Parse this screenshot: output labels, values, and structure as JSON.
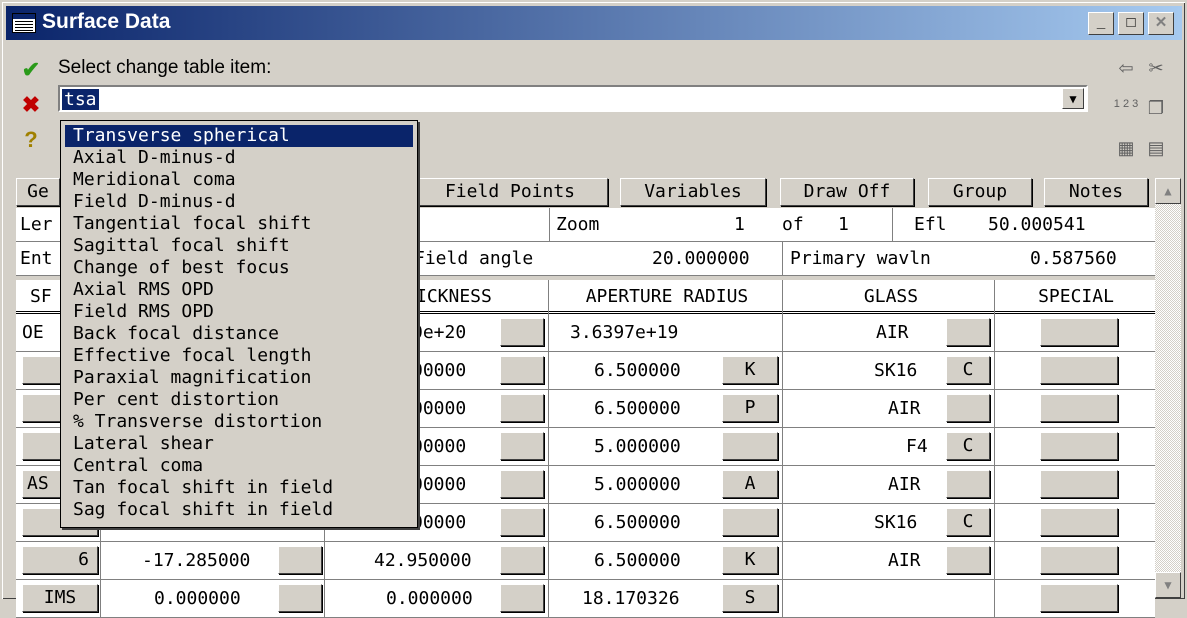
{
  "window": {
    "title": "Surface Data"
  },
  "title_buttons": {
    "minimize": "_",
    "maximize": "□",
    "close": "✕"
  },
  "left_buttons": {
    "accept": "✔",
    "cancel": "✖",
    "help": "?"
  },
  "prompt_label": "Select change table item:",
  "entry_value": "tsa",
  "dropdown_items": [
    "Transverse spherical",
    "Axial D-minus-d",
    "Meridional coma",
    "Field D-minus-d",
    "Tangential focal shift",
    "Sagittal focal shift",
    "Change of best focus",
    "Axial RMS OPD",
    "Field RMS OPD",
    "Back focal distance",
    "Effective focal length",
    "Paraxial magnification",
    "Per cent distortion",
    "% Transverse distortion",
    "Lateral shear",
    "Central coma",
    "Tan focal shift in field",
    "Sag focal shift in field"
  ],
  "tabs": [
    "Ge",
    "Field Points",
    "Variables",
    "Draw Off",
    "Group",
    "Notes"
  ],
  "info_row1": {
    "a": "Ler",
    "zoom_label": "Zoom",
    "zoom_val": "1",
    "of": "of",
    "of_val": "1",
    "efl_label": "Efl",
    "efl_val": "50.000541"
  },
  "info_row2": {
    "a": "Ent",
    "field_angle_label": "Field angle",
    "field_angle_val": "20.000000",
    "wavln_label": "Primary wavln",
    "wavln_val": "0.587560"
  },
  "headers": {
    "surf": "SF",
    "thick": "ICKNESS",
    "aperture": "APERTURE RADIUS",
    "glass": "GLASS",
    "special": "SPECIAL"
  },
  "rows": [
    {
      "surf": "OE",
      "thick": "0e+20",
      "ap": "3.6397e+19",
      "apbtn": "",
      "glass": "AIR",
      "gbtn": ""
    },
    {
      "surf": "",
      "thick": "00000",
      "ap": "6.500000",
      "apbtn": "K",
      "glass": "SK16",
      "gbtn": "C"
    },
    {
      "surf": "",
      "thick": "00000",
      "ap": "6.500000",
      "apbtn": "P",
      "glass": "AIR",
      "gbtn": ""
    },
    {
      "surf": "",
      "thick": "00000",
      "ap": "5.000000",
      "apbtn": "",
      "glass": "F4",
      "gbtn": "C"
    },
    {
      "surf": "AS",
      "thick": "00000",
      "ap": "5.000000",
      "apbtn": "A",
      "glass": "AIR",
      "gbtn": ""
    },
    {
      "surf": "",
      "thick": "00000",
      "ap": "6.500000",
      "apbtn": "",
      "glass": "SK16",
      "gbtn": "C"
    },
    {
      "surf": "6",
      "rad": "-17.285000",
      "thick": "42.950000",
      "ap": "6.500000",
      "apbtn": "K",
      "glass": "AIR",
      "gbtn": ""
    },
    {
      "surf": "IMS",
      "rad": "0.000000",
      "thick": "0.000000",
      "ap": "18.170326",
      "apbtn": "S",
      "glass": "",
      "gbtn": ""
    }
  ]
}
